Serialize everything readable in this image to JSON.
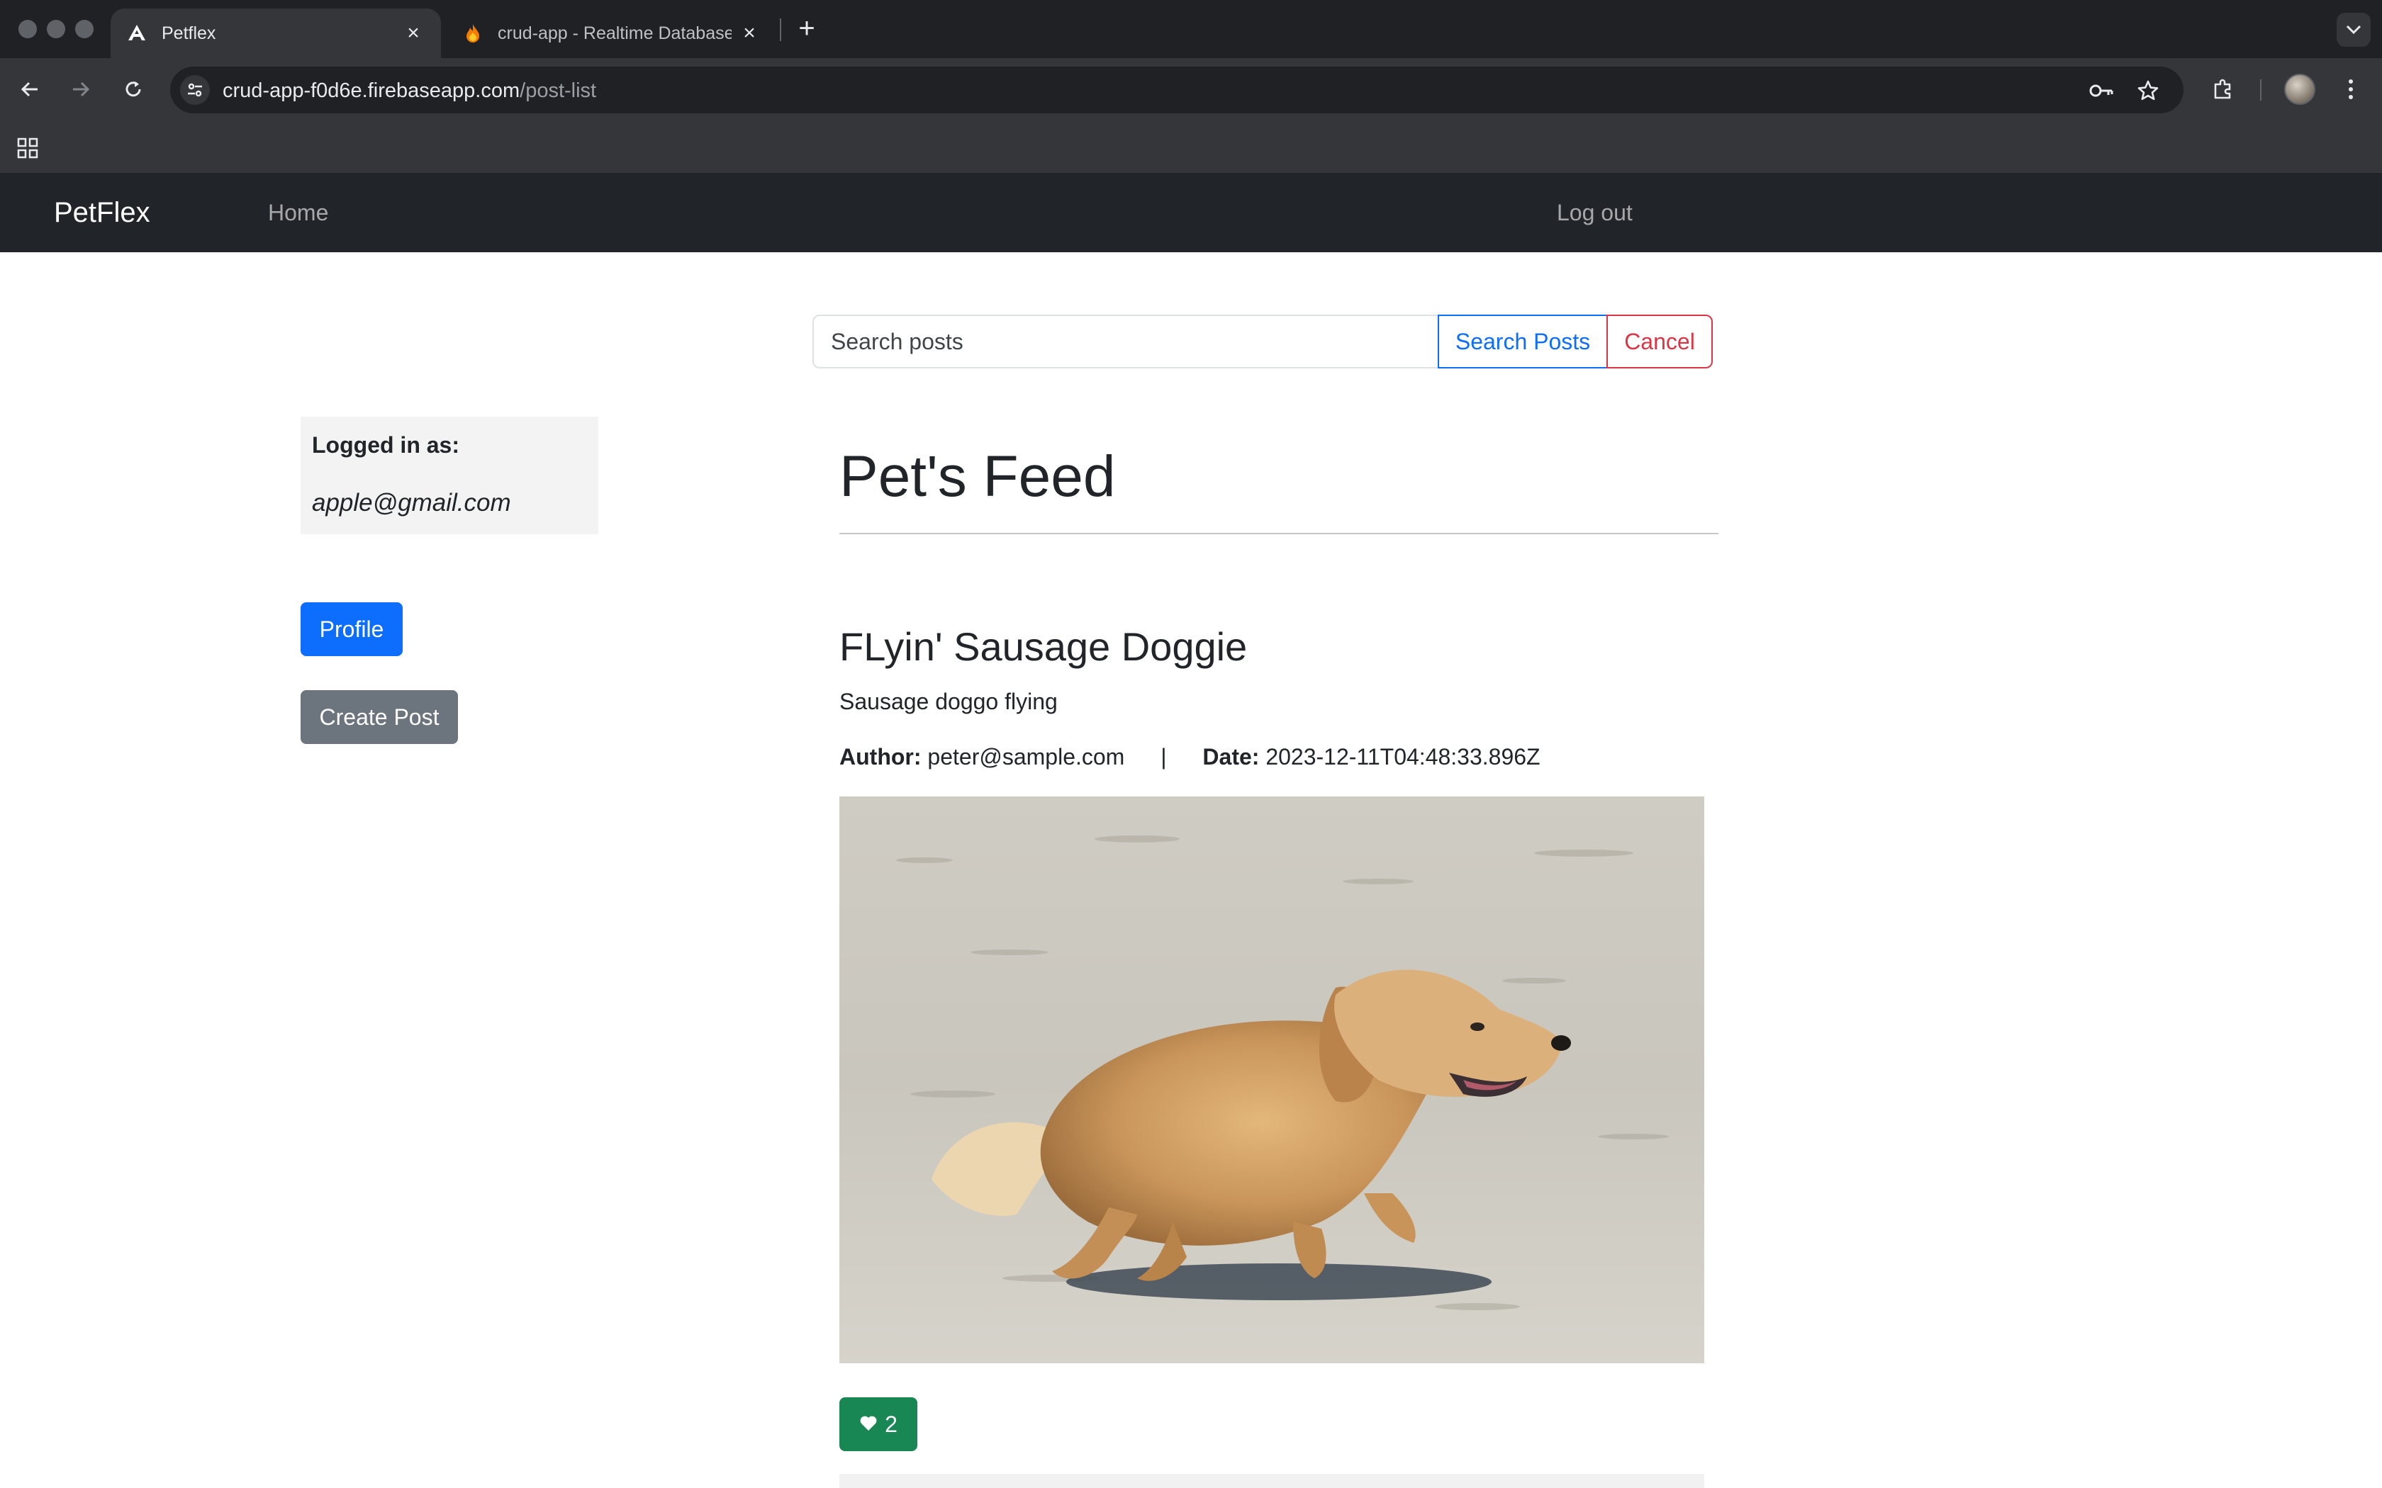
{
  "browser": {
    "tabs": [
      {
        "title": "Petflex",
        "active": true,
        "icon": "angular-logo-icon"
      },
      {
        "title": "crud-app - Realtime Database",
        "active": false,
        "icon": "firebase-flame-icon"
      }
    ],
    "url_host": "crud-app-f0d6e.firebaseapp.com",
    "url_path": "/post-list"
  },
  "navbar": {
    "brand": "PetFlex",
    "home": "Home",
    "logout": "Log out"
  },
  "search": {
    "placeholder": "Search posts",
    "search_label": "Search Posts",
    "cancel_label": "Cancel"
  },
  "sidebar": {
    "logged_in_label": "Logged in as:",
    "email": "apple@gmail.com",
    "profile_label": "Profile",
    "create_label": "Create Post"
  },
  "feed": {
    "title": "Pet's Feed",
    "post": {
      "title": "FLyin' Sausage Doggie",
      "description": "Sausage doggo flying",
      "author_label": "Author:",
      "author": "peter@sample.com",
      "separator": "|",
      "date_label": "Date:",
      "date": "2023-12-11T04:48:33.896Z",
      "likes": "2"
    }
  },
  "colors": {
    "primary": "#0d6efd",
    "danger": "#dc3545",
    "secondary": "#6c757d",
    "success": "#198754",
    "navbar": "#212529"
  }
}
